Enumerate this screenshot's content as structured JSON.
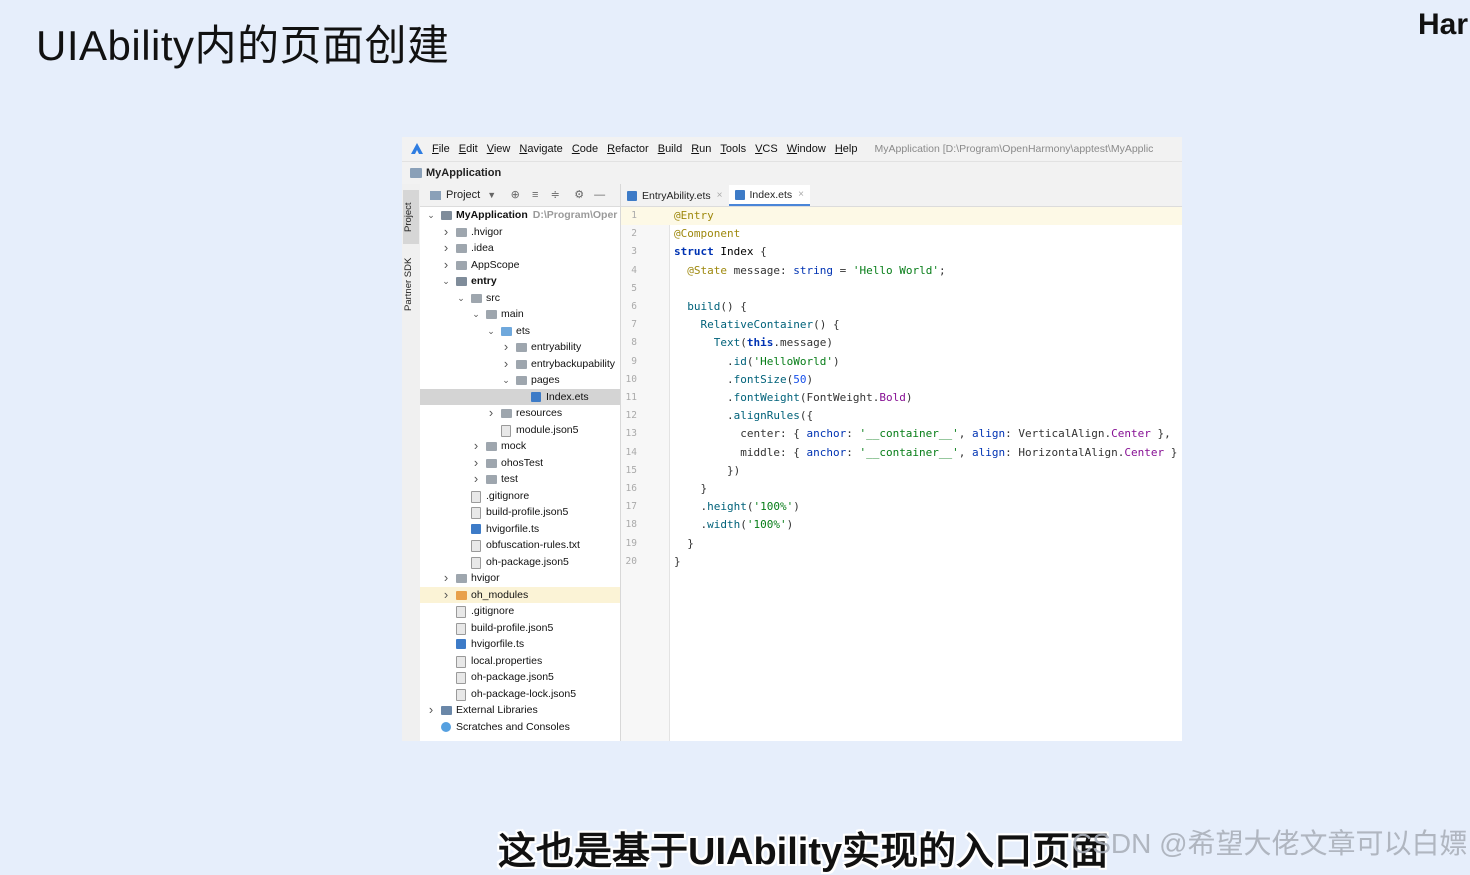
{
  "slide": {
    "title": "UIAbility内的页面创建",
    "brand": "Harr",
    "subtitle": "这也是基于UIAbility实现的入口页面",
    "watermark": "CSDN @希望大佬文章可以白嫖"
  },
  "ide": {
    "menu": [
      "File",
      "Edit",
      "View",
      "Navigate",
      "Code",
      "Refactor",
      "Build",
      "Run",
      "Tools",
      "VCS",
      "Window",
      "Help"
    ],
    "window_path": "MyApplication [D:\\Program\\OpenHarmony\\apptest\\MyApplic",
    "nav_project": "MyApplication",
    "side_tabs": {
      "project": "Project",
      "partner": "Partner SDK"
    },
    "panel": {
      "view_label": "Project"
    },
    "tabs": [
      {
        "label": "EntryAbility.ets",
        "active": false
      },
      {
        "label": "Index.ets",
        "active": true
      }
    ],
    "tree": [
      {
        "label": "MyApplication",
        "hint": "D:\\Program\\Oper",
        "depth": 0,
        "arrow": "down",
        "icon": "module",
        "bold": true
      },
      {
        "label": ".hvigor",
        "depth": 1,
        "arrow": "right",
        "icon": "folder"
      },
      {
        "label": ".idea",
        "depth": 1,
        "arrow": "right",
        "icon": "folder"
      },
      {
        "label": "AppScope",
        "depth": 1,
        "arrow": "right",
        "icon": "folder"
      },
      {
        "label": "entry",
        "depth": 1,
        "arrow": "down",
        "icon": "module",
        "bold": true
      },
      {
        "label": "src",
        "depth": 2,
        "arrow": "down",
        "icon": "folder"
      },
      {
        "label": "main",
        "depth": 3,
        "arrow": "down",
        "icon": "folder"
      },
      {
        "label": "ets",
        "depth": 4,
        "arrow": "down",
        "icon": "folder-blue"
      },
      {
        "label": "entryability",
        "depth": 5,
        "arrow": "right",
        "icon": "folder"
      },
      {
        "label": "entrybackupability",
        "depth": 5,
        "arrow": "right",
        "icon": "folder"
      },
      {
        "label": "pages",
        "depth": 5,
        "arrow": "down",
        "icon": "folder"
      },
      {
        "label": "Index.ets",
        "depth": 6,
        "arrow": "",
        "icon": "ets",
        "selected": true
      },
      {
        "label": "resources",
        "depth": 4,
        "arrow": "right",
        "icon": "folder"
      },
      {
        "label": "module.json5",
        "depth": 4,
        "arrow": "",
        "icon": "file"
      },
      {
        "label": "mock",
        "depth": 3,
        "arrow": "right",
        "icon": "folder"
      },
      {
        "label": "ohosTest",
        "depth": 3,
        "arrow": "right",
        "icon": "folder"
      },
      {
        "label": "test",
        "depth": 3,
        "arrow": "right",
        "icon": "folder"
      },
      {
        "label": ".gitignore",
        "depth": 2,
        "arrow": "",
        "icon": "file"
      },
      {
        "label": "build-profile.json5",
        "depth": 2,
        "arrow": "",
        "icon": "file"
      },
      {
        "label": "hvigorfile.ts",
        "depth": 2,
        "arrow": "",
        "icon": "ets"
      },
      {
        "label": "obfuscation-rules.txt",
        "depth": 2,
        "arrow": "",
        "icon": "file"
      },
      {
        "label": "oh-package.json5",
        "depth": 2,
        "arrow": "",
        "icon": "file"
      },
      {
        "label": "hvigor",
        "depth": 1,
        "arrow": "right",
        "icon": "folder"
      },
      {
        "label": "oh_modules",
        "depth": 1,
        "arrow": "right",
        "icon": "folder-orange",
        "highlight": true
      },
      {
        "label": ".gitignore",
        "depth": 1,
        "arrow": "",
        "icon": "file"
      },
      {
        "label": "build-profile.json5",
        "depth": 1,
        "arrow": "",
        "icon": "file"
      },
      {
        "label": "hvigorfile.ts",
        "depth": 1,
        "arrow": "",
        "icon": "ets"
      },
      {
        "label": "local.properties",
        "depth": 1,
        "arrow": "",
        "icon": "file"
      },
      {
        "label": "oh-package.json5",
        "depth": 1,
        "arrow": "",
        "icon": "file"
      },
      {
        "label": "oh-package-lock.json5",
        "depth": 1,
        "arrow": "",
        "icon": "file"
      },
      {
        "label": "External Libraries",
        "depth": 0,
        "arrow": "right",
        "icon": "lib"
      },
      {
        "label": "Scratches and Consoles",
        "depth": 0,
        "arrow": "",
        "icon": "scratch"
      }
    ],
    "code": [
      {
        "n": "1",
        "current": true,
        "tokens": [
          [
            "ann",
            "@Entry"
          ]
        ]
      },
      {
        "n": "2",
        "tokens": [
          [
            "ann",
            "@Component"
          ]
        ]
      },
      {
        "n": "3",
        "tokens": [
          [
            "kw",
            "struct"
          ],
          [
            "punc",
            " "
          ],
          [
            "type",
            "Index"
          ],
          [
            "punc",
            " {"
          ]
        ]
      },
      {
        "n": "4",
        "tokens": [
          [
            "punc",
            "  "
          ],
          [
            "ann",
            "@State"
          ],
          [
            "punc",
            " message: "
          ],
          [
            "kwn",
            "string"
          ],
          [
            "punc",
            " = "
          ],
          [
            "str",
            "'Hello World'"
          ],
          [
            "punc",
            ";"
          ]
        ]
      },
      {
        "n": "5",
        "tokens": []
      },
      {
        "n": "6",
        "tokens": [
          [
            "punc",
            "  "
          ],
          [
            "fn",
            "build"
          ],
          [
            "punc",
            "() {"
          ]
        ]
      },
      {
        "n": "7",
        "tokens": [
          [
            "punc",
            "    "
          ],
          [
            "fn",
            "RelativeContainer"
          ],
          [
            "punc",
            "() {"
          ]
        ]
      },
      {
        "n": "8",
        "tokens": [
          [
            "punc",
            "      "
          ],
          [
            "fn",
            "Text"
          ],
          [
            "punc",
            "("
          ],
          [
            "kw",
            "this"
          ],
          [
            "punc",
            ".message)"
          ]
        ]
      },
      {
        "n": "9",
        "tokens": [
          [
            "punc",
            "        ."
          ],
          [
            "fn",
            "id"
          ],
          [
            "punc",
            "("
          ],
          [
            "str",
            "'HelloWorld'"
          ],
          [
            "punc",
            ")"
          ]
        ]
      },
      {
        "n": "10",
        "tokens": [
          [
            "punc",
            "        ."
          ],
          [
            "fn",
            "fontSize"
          ],
          [
            "punc",
            "("
          ],
          [
            "num",
            "50"
          ],
          [
            "punc",
            ")"
          ]
        ]
      },
      {
        "n": "11",
        "tokens": [
          [
            "punc",
            "        ."
          ],
          [
            "fn",
            "fontWeight"
          ],
          [
            "punc",
            "(FontWeight."
          ],
          [
            "prop",
            "Bold"
          ],
          [
            "punc",
            ")"
          ]
        ]
      },
      {
        "n": "12",
        "tokens": [
          [
            "punc",
            "        ."
          ],
          [
            "fn",
            "alignRules"
          ],
          [
            "punc",
            "({"
          ]
        ]
      },
      {
        "n": "13",
        "tokens": [
          [
            "punc",
            "          center: { "
          ],
          [
            "kwn",
            "anchor"
          ],
          [
            "punc",
            ": "
          ],
          [
            "str",
            "'__container__'"
          ],
          [
            "punc",
            ", "
          ],
          [
            "kwn",
            "align"
          ],
          [
            "punc",
            ": VerticalAlign."
          ],
          [
            "prop",
            "Center"
          ],
          [
            "punc",
            " },"
          ]
        ]
      },
      {
        "n": "14",
        "tokens": [
          [
            "punc",
            "          middle: { "
          ],
          [
            "kwn",
            "anchor"
          ],
          [
            "punc",
            ": "
          ],
          [
            "str",
            "'__container__'"
          ],
          [
            "punc",
            ", "
          ],
          [
            "kwn",
            "align"
          ],
          [
            "punc",
            ": HorizontalAlign."
          ],
          [
            "prop",
            "Center"
          ],
          [
            "punc",
            " }"
          ]
        ]
      },
      {
        "n": "15",
        "tokens": [
          [
            "punc",
            "        })"
          ]
        ]
      },
      {
        "n": "16",
        "tokens": [
          [
            "punc",
            "    }"
          ]
        ]
      },
      {
        "n": "17",
        "tokens": [
          [
            "punc",
            "    ."
          ],
          [
            "fn",
            "height"
          ],
          [
            "punc",
            "("
          ],
          [
            "str",
            "'100%'"
          ],
          [
            "punc",
            ")"
          ]
        ]
      },
      {
        "n": "18",
        "tokens": [
          [
            "punc",
            "    ."
          ],
          [
            "fn",
            "width"
          ],
          [
            "punc",
            "("
          ],
          [
            "str",
            "'100%'"
          ],
          [
            "punc",
            ")"
          ]
        ]
      },
      {
        "n": "19",
        "tokens": [
          [
            "punc",
            "  }"
          ]
        ]
      },
      {
        "n": "20",
        "tokens": [
          [
            "punc",
            "}"
          ]
        ]
      }
    ]
  }
}
